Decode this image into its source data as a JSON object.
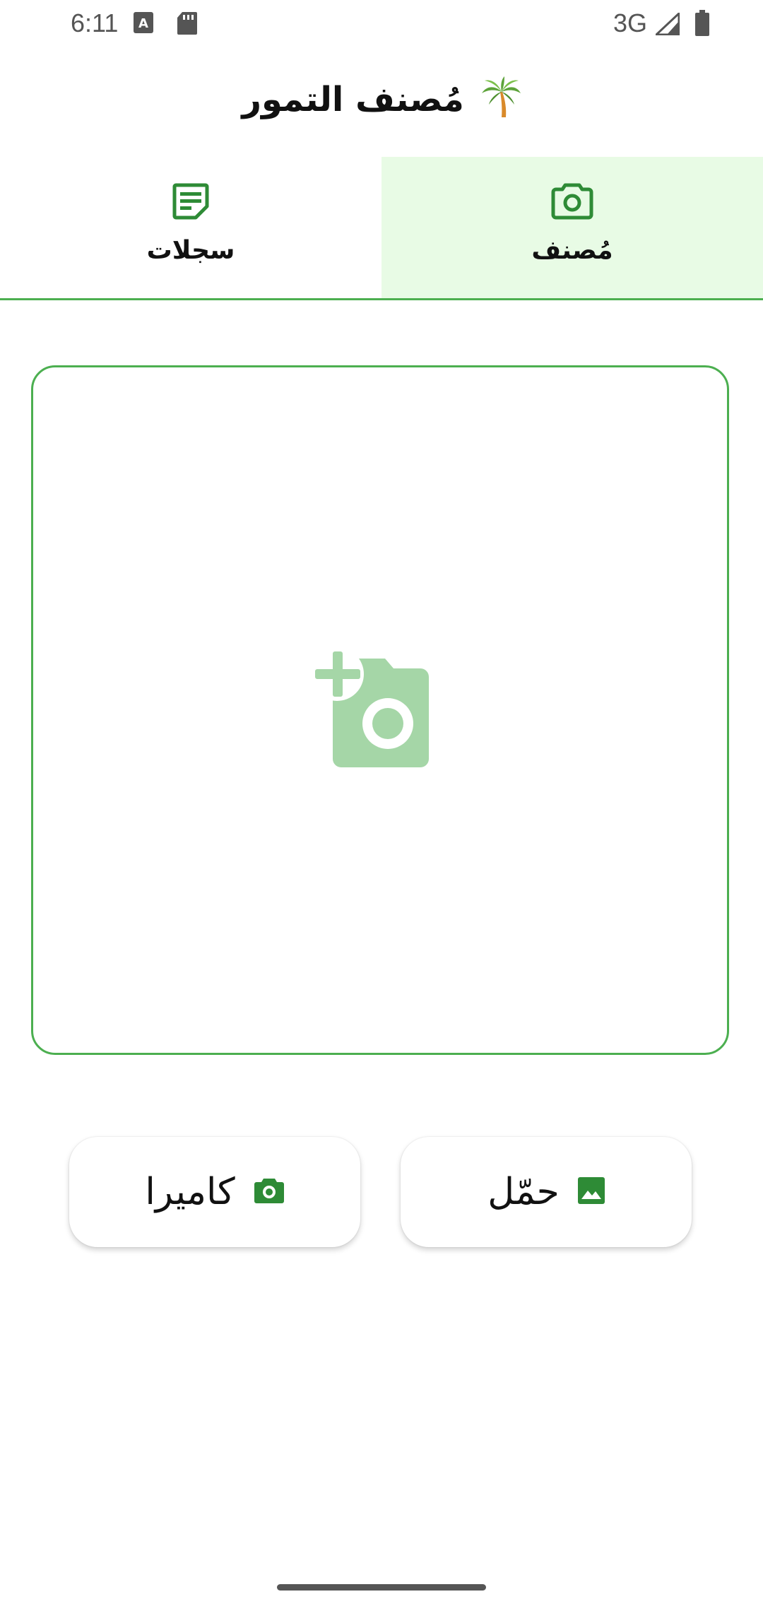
{
  "status_bar": {
    "time": "6:11",
    "network": "3G",
    "icons": [
      "keyboard-a-icon",
      "sd-card-icon",
      "signal-icon",
      "battery-icon"
    ]
  },
  "header": {
    "title": "مُصنف التمور",
    "icon": "palm-tree-icon"
  },
  "tabs": [
    {
      "label": "مُصنف",
      "icon": "camera-icon",
      "active": true
    },
    {
      "label": "سجلات",
      "icon": "notes-icon",
      "active": false
    }
  ],
  "dropzone": {
    "icon": "add-a-photo-icon"
  },
  "buttons": {
    "gallery": {
      "label": "حمّل",
      "icon": "image-icon"
    },
    "camera": {
      "label": "كاميرا",
      "icon": "camera-icon"
    }
  },
  "colors": {
    "accent": "#2e8b36",
    "border": "#4caf50",
    "active_tab_bg": "#e8fbe5",
    "placeholder_icon": "#a5d6a7"
  }
}
